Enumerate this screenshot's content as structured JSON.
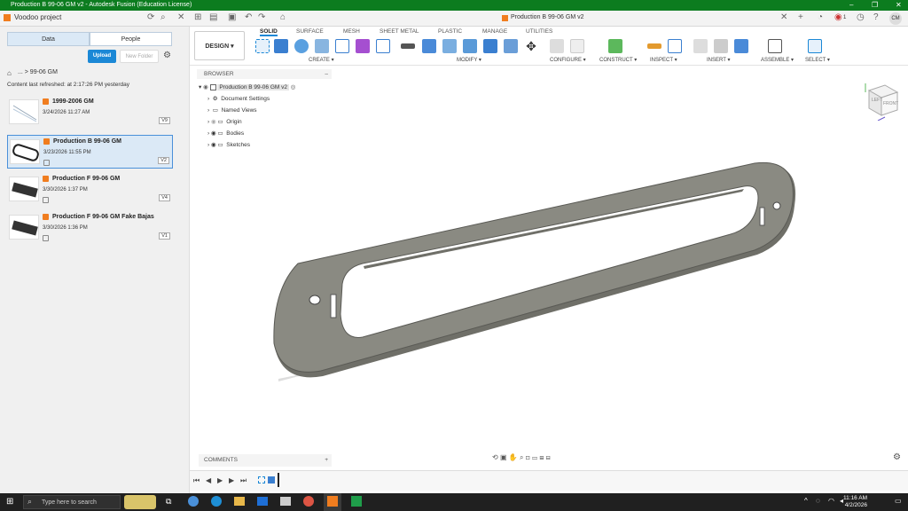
{
  "window": {
    "title": "Production B 99-06 GM v2 - Autodesk Fusion (Education License)"
  },
  "appbar": {
    "project": "Voodoo project",
    "doc_tab": "Production B 99-06 GM v2",
    "badge_count": "1",
    "user_initials": "CM"
  },
  "sidebar": {
    "tabs": [
      "Data",
      "People"
    ],
    "upload_label": "Upload",
    "new_folder_label": "New Folder",
    "breadcrumb": "...  >  99-06 GM",
    "refresh_text": "Content last refreshed: at 2:17:26 PM yesterday",
    "files": [
      {
        "name": "1999-2006 GM",
        "date": "3/24/2026 11:27 AM",
        "version": "V9"
      },
      {
        "name": "Production B 99-06 GM",
        "date": "3/23/2026 11:55 PM",
        "version": "V2"
      },
      {
        "name": "Production F 99-06 GM",
        "date": "3/30/2026 1:37 PM",
        "version": "V4"
      },
      {
        "name": "Production F 99-06 GM Fake Bajas",
        "date": "3/30/2026 1:36 PM",
        "version": "V1"
      }
    ]
  },
  "toolbar": {
    "design_label": "DESIGN",
    "tabs": [
      "SOLID",
      "SURFACE",
      "MESH",
      "SHEET METAL",
      "PLASTIC",
      "MANAGE",
      "UTILITIES"
    ],
    "groups": [
      "CREATE",
      "MODIFY",
      "CONFIGURE",
      "CONSTRUCT",
      "INSPECT",
      "INSERT",
      "ASSEMBLE",
      "SELECT"
    ]
  },
  "browser": {
    "title": "BROWSER",
    "root": "Production B 99-06 GM v2",
    "items": [
      "Document Settings",
      "Named Views",
      "Origin",
      "Bodies",
      "Sketches"
    ]
  },
  "viewcube": {
    "top": "TOP",
    "front": "FRONT",
    "left": "LEFT"
  },
  "bottom": {
    "comments": "COMMENTS"
  },
  "taskbar": {
    "search_placeholder": "Type here to search",
    "time": "11:16 AM",
    "date": "4/2/2026"
  },
  "colors": {
    "titlebar": "#0c7c1f",
    "accent": "#1b88d6",
    "part": "#8a8a82"
  }
}
